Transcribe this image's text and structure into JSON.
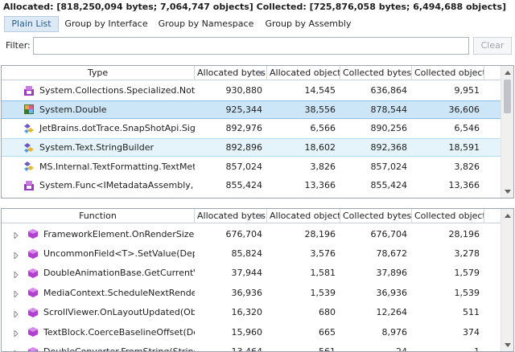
{
  "summary": "Allocated: [818,250,094 bytes; 7,064,747 objects] Collected: [725,876,058 bytes; 6,494,688 objects]",
  "tabs": [
    {
      "label": "Plain List",
      "active": true
    },
    {
      "label": "Group by Interface",
      "active": false
    },
    {
      "label": "Group by Namespace",
      "active": false
    },
    {
      "label": "Group by Assembly",
      "active": false
    }
  ],
  "filter": {
    "label": "Filter:",
    "value": "",
    "placeholder": "",
    "clear_label": "Clear"
  },
  "types_table": {
    "columns": [
      "Type",
      "Allocated bytes",
      "Allocated objects",
      "Collected bytes",
      "Collected objects"
    ],
    "rows": [
      {
        "icon": "class-icon",
        "name": "System.Collections.Specialized.NotifyCo",
        "alloc_bytes": "930,880",
        "alloc_objects": "14,545",
        "coll_bytes": "636,864",
        "coll_objects": "9,951",
        "state": ""
      },
      {
        "icon": "struct-icon",
        "name": "System.Double",
        "alloc_bytes": "925,344",
        "alloc_objects": "38,556",
        "coll_bytes": "878,544",
        "coll_objects": "36,606",
        "state": "selected"
      },
      {
        "icon": "generic-class-icon",
        "name": "JetBrains.dotTrace.SnapShotApi.Signatu",
        "alloc_bytes": "892,976",
        "alloc_objects": "6,566",
        "coll_bytes": "890,256",
        "coll_objects": "6,546",
        "state": ""
      },
      {
        "icon": "generic-class-icon",
        "name": "System.Text.StringBuilder",
        "alloc_bytes": "892,896",
        "alloc_objects": "18,602",
        "coll_bytes": "892,368",
        "coll_objects": "18,591",
        "state": "hovered"
      },
      {
        "icon": "generic-class-icon",
        "name": "MS.Internal.TextFormatting.TextMetrics",
        "alloc_bytes": "857,024",
        "alloc_objects": "3,826",
        "coll_bytes": "857,024",
        "coll_objects": "3,826",
        "state": ""
      },
      {
        "icon": "class-icon",
        "name": "System.Func<IMetadataAssembly, Boo",
        "alloc_bytes": "855,424",
        "alloc_objects": "13,366",
        "coll_bytes": "855,424",
        "coll_objects": "13,366",
        "state": ""
      }
    ]
  },
  "functions_table": {
    "columns": [
      "Function",
      "Allocated bytes",
      "Allocated objects",
      "Collected bytes",
      "Collected objects"
    ],
    "rows": [
      {
        "name": "FrameworkElement.OnRenderSizeChang",
        "alloc_bytes": "676,704",
        "alloc_objects": "28,196",
        "coll_bytes": "676,704",
        "coll_objects": "28,196"
      },
      {
        "name": "UncommonField<T>.SetValue(Depender",
        "alloc_bytes": "85,824",
        "alloc_objects": "3,576",
        "coll_bytes": "78,672",
        "coll_objects": "3,278"
      },
      {
        "name": "DoubleAnimationBase.GetCurrentValue(",
        "alloc_bytes": "37,944",
        "alloc_objects": "1,581",
        "coll_bytes": "37,896",
        "coll_objects": "1,579"
      },
      {
        "name": "MediaContext.ScheduleNextRenderOp(T",
        "alloc_bytes": "36,936",
        "alloc_objects": "1,539",
        "coll_bytes": "36,936",
        "coll_objects": "1,539"
      },
      {
        "name": "ScrollViewer.OnLayoutUpdated(Object s",
        "alloc_bytes": "16,320",
        "alloc_objects": "680",
        "coll_bytes": "12,264",
        "coll_objects": "511"
      },
      {
        "name": "TextBlock.CoerceBaselineOffset(Depend",
        "alloc_bytes": "15,960",
        "alloc_objects": "665",
        "coll_bytes": "8,976",
        "coll_objects": "374"
      },
      {
        "name": "DoubleConverter.FromString(String valu",
        "alloc_bytes": "13,464",
        "alloc_objects": "561",
        "coll_bytes": "24",
        "coll_objects": "1"
      }
    ]
  },
  "colors": {
    "accent": "#2a5b90",
    "selected_row": "#cde6f7",
    "hover_row": "#e5f3fb",
    "method_icon": "#b23fd1"
  }
}
